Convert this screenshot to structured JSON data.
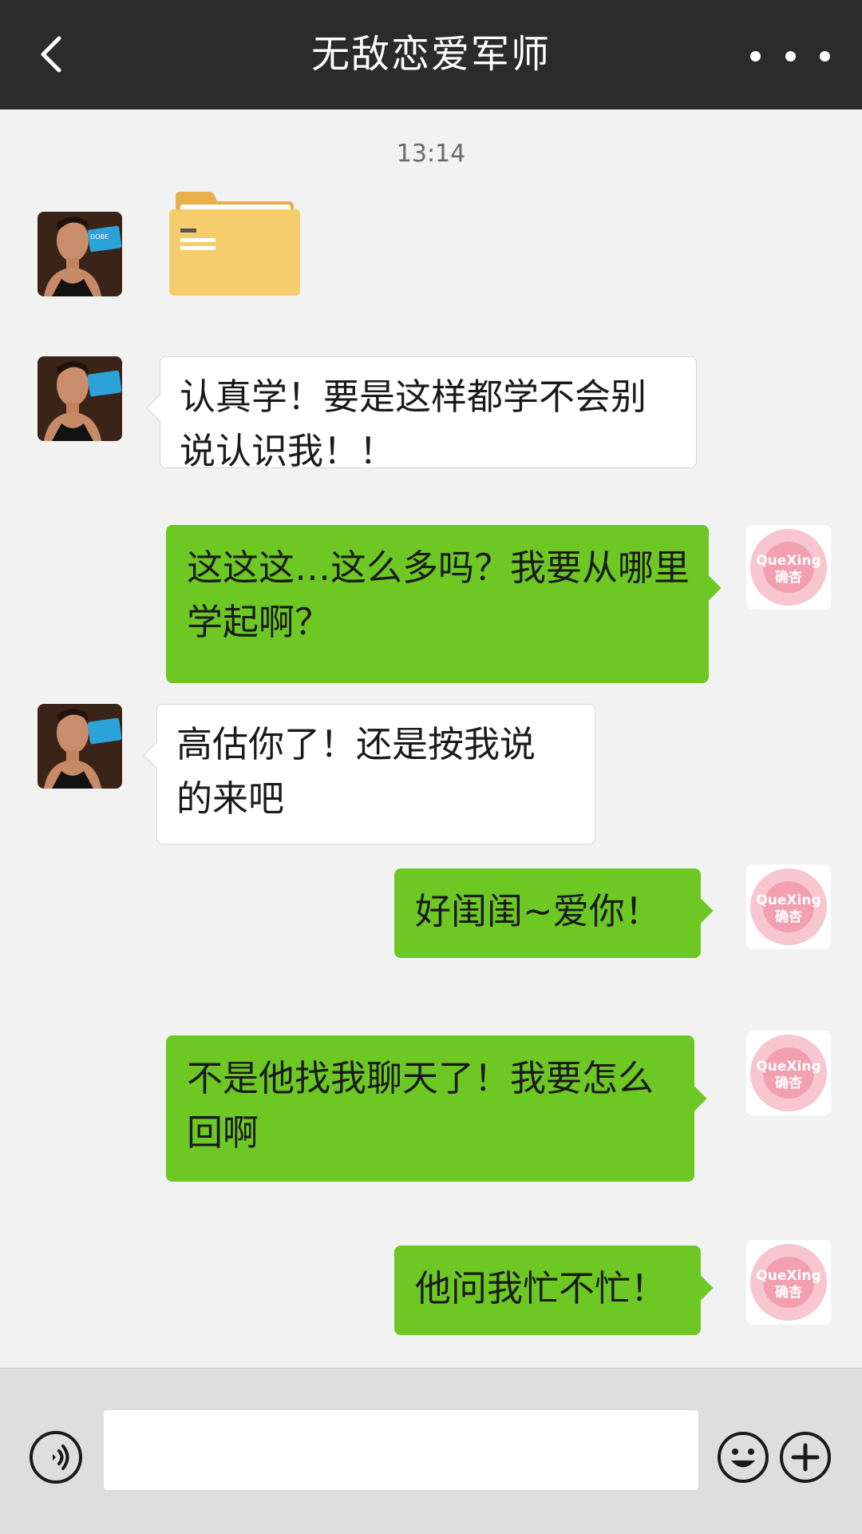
{
  "header": {
    "title": "无敌恋爱军师",
    "back_icon": "chevron-left-icon",
    "more_icon": "more-dots-icon"
  },
  "chat": {
    "timestamp": "13:14",
    "messages": [
      {
        "side": "left",
        "type": "file",
        "icon": "folder-icon"
      },
      {
        "side": "left",
        "type": "text",
        "text": "认真学！要是这样都学不会别说认识我！！"
      },
      {
        "side": "right",
        "type": "text",
        "text": "这这这…这么多吗？我要从哪里学起啊？"
      },
      {
        "side": "left",
        "type": "text",
        "text": "高估你了！还是按我说 的来吧"
      },
      {
        "side": "right",
        "type": "text",
        "text": "好闺闺~爱你！"
      },
      {
        "side": "right",
        "type": "text",
        "text": "不是他找我聊天了！我要怎么回啊"
      },
      {
        "side": "right",
        "type": "text",
        "text": "他问我忙不忙！"
      }
    ]
  },
  "avatar_right": {
    "line1": "QueXing",
    "line2": "确杏"
  },
  "avatar_left_card_text": "DOBE",
  "input_bar": {
    "text_value": "",
    "voice_icon": "voice-icon",
    "emoji_icon": "emoji-icon",
    "plus_icon": "plus-icon"
  },
  "colors": {
    "header_bg": "#2b2b2b",
    "outgoing_bubble": "#6ec824",
    "incoming_bubble": "#ffffff",
    "chat_bg": "#f2f2f2",
    "input_bar_bg": "#dedede"
  }
}
